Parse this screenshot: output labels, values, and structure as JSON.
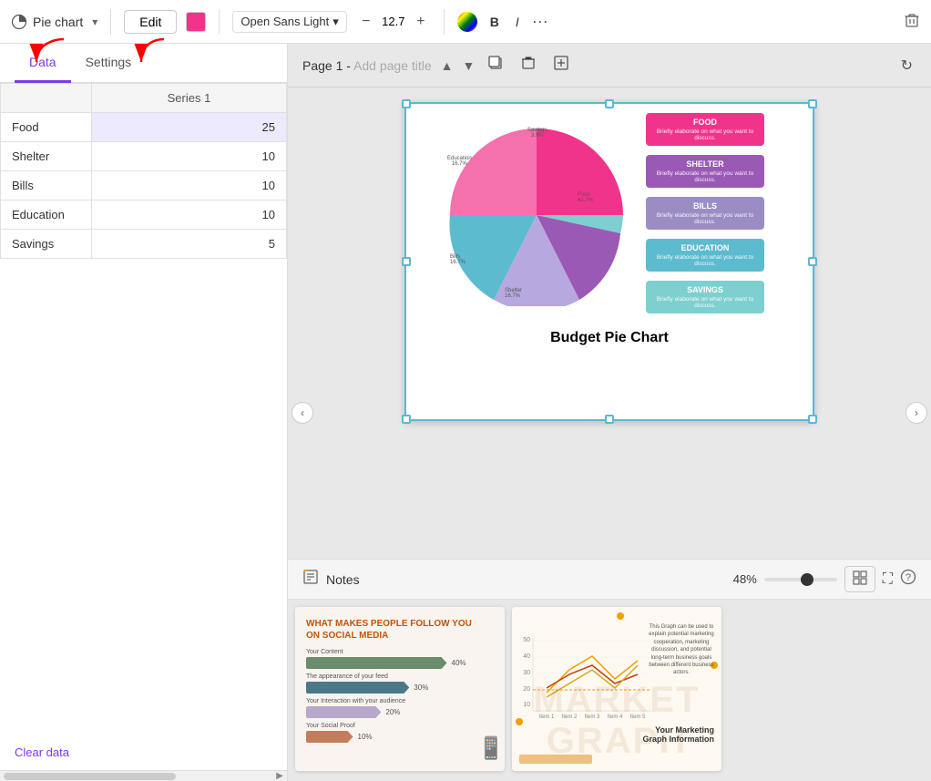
{
  "toolbar": {
    "chart_type": "Pie chart",
    "edit_label": "Edit",
    "font_name": "Open Sans Light",
    "font_size": "12.7",
    "font_size_decrease": "−",
    "font_size_increase": "+",
    "bold_label": "B",
    "italic_label": "I",
    "more_label": "···"
  },
  "sidebar": {
    "tab_data": "Data",
    "tab_settings": "Settings",
    "table": {
      "header": "Series 1",
      "rows": [
        {
          "label": "Food",
          "value": 25
        },
        {
          "label": "Shelter",
          "value": 10
        },
        {
          "label": "Bills",
          "value": 10
        },
        {
          "label": "Education",
          "value": 10
        },
        {
          "label": "Savings",
          "value": 5
        }
      ]
    },
    "clear_data": "Clear data"
  },
  "page_header": {
    "page_label": "Page 1",
    "separator": "-",
    "add_title": "Add page title"
  },
  "slide": {
    "title": "Budget Pie Chart",
    "legend": [
      {
        "label": "FOOD",
        "sub": "Briefly elaborate on what you want to discuss.",
        "color": "#f0348c"
      },
      {
        "label": "SHELTER",
        "sub": "Briefly elaborate on what you want to discuss.",
        "color": "#9b59b6"
      },
      {
        "label": "BILLS",
        "sub": "Briefly elaborate on what you want to discuss.",
        "color": "#9b8dc4"
      },
      {
        "label": "EDUCATION",
        "sub": "Briefly elaborate on what you want to discuss.",
        "color": "#5dbbcf"
      },
      {
        "label": "SAVINGS",
        "sub": "Briefly elaborate on what you want to discuss.",
        "color": "#7ecfcf"
      }
    ],
    "pie_labels": [
      {
        "text": "Savings\n3.9%",
        "top": "2%",
        "left": "55%"
      },
      {
        "text": "Education\n16.7%",
        "top": "18%",
        "left": "0%"
      },
      {
        "text": "Food\n41.7%",
        "top": "38%",
        "left": "58%"
      },
      {
        "text": "Bills\n16.7%",
        "top": "70%",
        "left": "5%"
      },
      {
        "text": "Shelter\n16.7%",
        "top": "85%",
        "left": "42%"
      }
    ]
  },
  "notes_bar": {
    "notes_label": "Notes",
    "zoom_percent": "48%"
  },
  "slides_strip": {
    "social_slide": {
      "title_line1": "WHAT MAKES PEOPLE FOLLOW YOU",
      "title_line2": "ON SOCIAL MEDIA",
      "bars": [
        {
          "label": "Your Content",
          "pct": "40%",
          "width": "75%",
          "color": "#6b8c6b"
        },
        {
          "label": "The appearance of your feed",
          "pct": "30%",
          "width": "55%",
          "color": "#4a7a8a"
        },
        {
          "label": "Your Interaction with your audience",
          "pct": "20%",
          "width": "40%",
          "color": "#b8a8cc"
        },
        {
          "label": "Your Social Proof",
          "pct": "10%",
          "width": "25%",
          "color": "#c47c5c"
        }
      ]
    },
    "marketing_slide": {
      "bg_text": "MARKET\nGRAPH",
      "title_line1": "Your Marketing",
      "title_line2": "Graph Information",
      "description": "This Graph can be used to explain potential marketing cooperation, marketing discussion, and potential long-term business goals between different business actors.",
      "axis_labels": [
        "Item 1",
        "Item 2",
        "Item 3",
        "Item 4",
        "Item 5"
      ]
    }
  }
}
